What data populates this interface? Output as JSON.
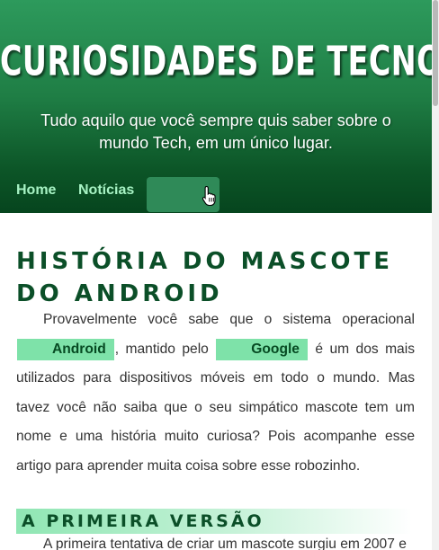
{
  "header": {
    "title": "CURIOSIDADES DE TECNOLOGIA",
    "subtitle": "Tudo aquilo que você sempre quis saber sobre o mundo Tech, em um único lugar."
  },
  "nav": {
    "items": [
      {
        "label": "Home"
      },
      {
        "label": "Notícias"
      }
    ],
    "cursor_icon": "hand-pointer-icon"
  },
  "article": {
    "title": "HISTÓRIA DO MASCOTE DO ANDROID",
    "intro": {
      "text1": "Provavelmente você sabe que o sistema operacional ",
      "tag1": "Android",
      "text2": ", mantido pelo ",
      "tag2": "Google",
      "text3": " é um dos mais utilizados para dispositivos móveis em todo o mundo. Mas tavez você não saiba que o seu simpático mascote tem um nome e uma história muito curiosa? Pois acompanhe esse artigo para aprender muita coisa sobre esse robozinho."
    },
    "section1": {
      "heading": "A PRIMEIRA VERSÃO",
      "text": "A primeira tentativa de criar um mascote surgiu em 2007 e"
    }
  },
  "colors": {
    "header_top": "#2d9a5c",
    "header_bottom": "#06451e",
    "nav_link": "#a7f3c4",
    "tag_bg": "#7ee2a9",
    "heading_text": "#0b4f28"
  }
}
